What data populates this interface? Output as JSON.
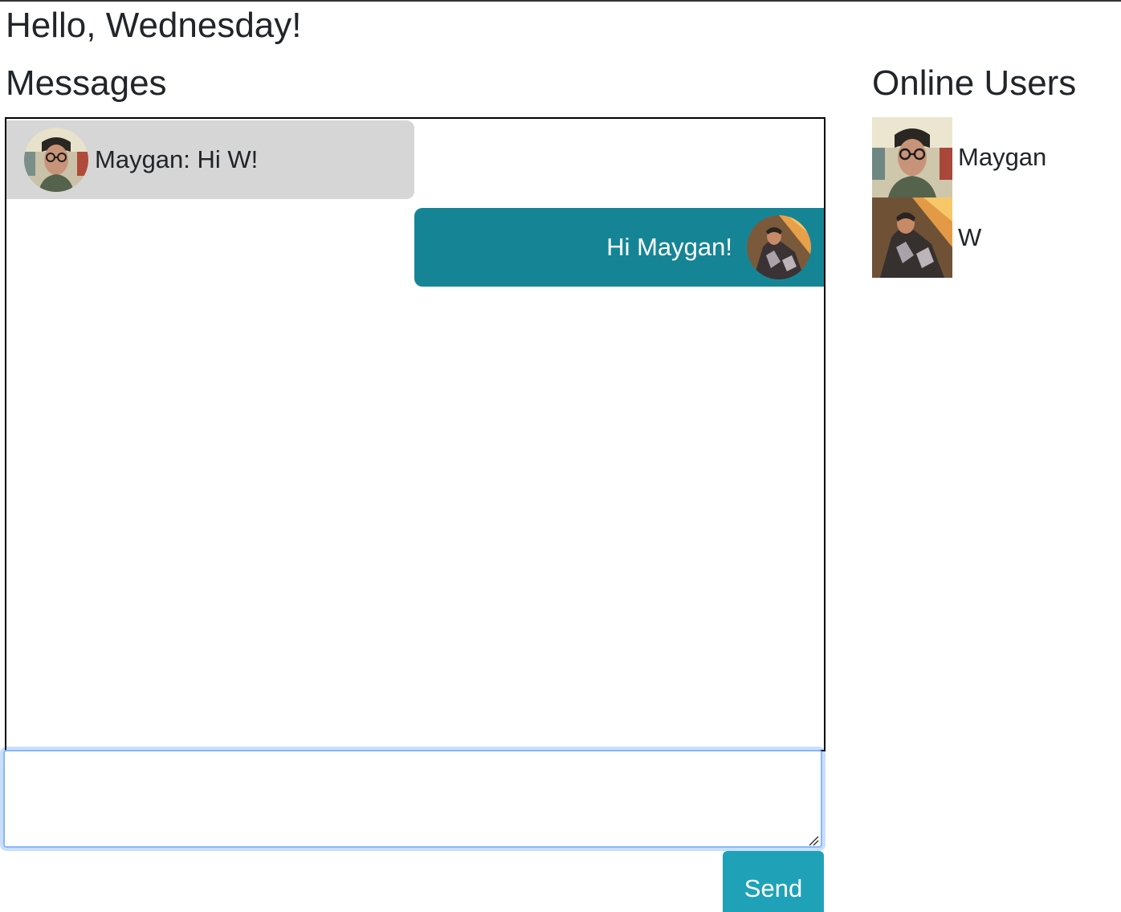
{
  "greeting": "Hello, Wednesday!",
  "messages": {
    "heading": "Messages",
    "items": [
      {
        "from": "Maygan",
        "text": "Maygan: Hi W!",
        "direction": "received",
        "avatar_icon": "maygan-avatar-icon"
      },
      {
        "from": "W",
        "text": "Hi Maygan!",
        "direction": "sent",
        "avatar_icon": "w-avatar-icon"
      }
    ]
  },
  "composer": {
    "value": "",
    "send_label": "Send"
  },
  "online_users": {
    "heading": "Online Users",
    "users": [
      {
        "name": "Maygan",
        "photo_icon": "maygan-photo-icon"
      },
      {
        "name": "W",
        "photo_icon": "w-photo-icon"
      }
    ]
  },
  "colors": {
    "received_bubble": "#d6d6d6",
    "sent_bubble": "#158596",
    "send_button": "#1fa2b8",
    "focus_ring": "#86b7fe"
  }
}
